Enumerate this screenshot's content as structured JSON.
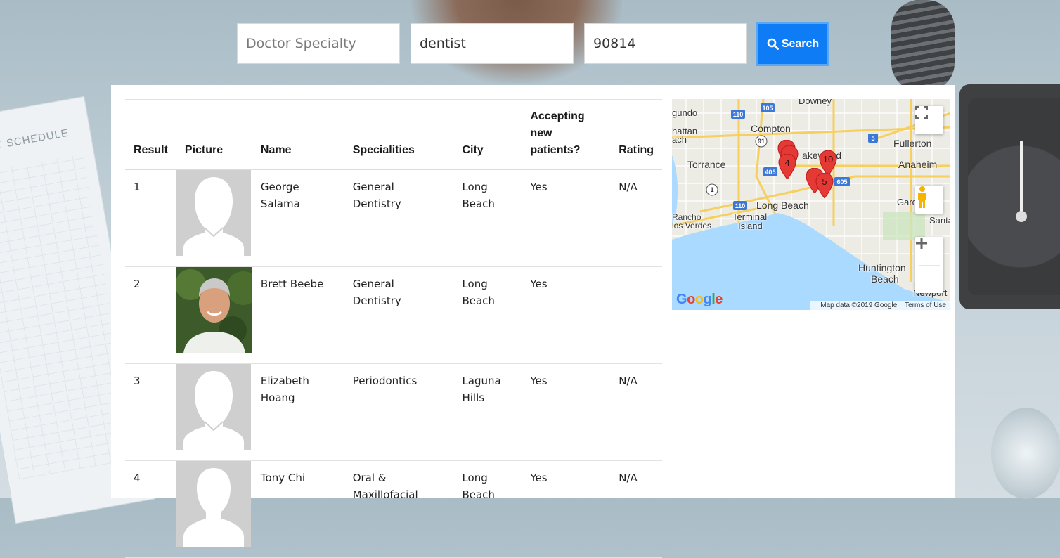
{
  "search": {
    "specialty_placeholder": "Doctor Specialty",
    "keyword_value": "dentist",
    "zip_value": "90814",
    "button_label": "Search"
  },
  "background": {
    "clipboard_text": "PORT SCHEDULE"
  },
  "table": {
    "headers": {
      "result": "Result",
      "picture": "Picture",
      "name": "Name",
      "specialities": "Specialities",
      "city": "City",
      "accepting": "Accepting new patients?",
      "rating": "Rating"
    },
    "rows": [
      {
        "result": "1",
        "name": "George Salama",
        "speciality": "General Dentistry",
        "city": "Long Beach",
        "accepting": "Yes",
        "rating": "N/A",
        "picture": "placeholder"
      },
      {
        "result": "2",
        "name": "Brett Beebe",
        "speciality": "General Dentistry",
        "city": "Long Beach",
        "accepting": "Yes",
        "rating": "",
        "picture": "photo"
      },
      {
        "result": "3",
        "name": "Elizabeth Hoang",
        "speciality": "Periodontics",
        "city": "Laguna Hills",
        "accepting": "Yes",
        "rating": "N/A",
        "picture": "placeholder"
      },
      {
        "result": "4",
        "name": "Tony Chi",
        "speciality": "Oral & Maxillofacial",
        "city": "Long Beach",
        "accepting": "Yes",
        "rating": "N/A",
        "picture": "placeholder"
      }
    ]
  },
  "map": {
    "labels": {
      "downey": "Downey",
      "compton": "Compton",
      "lakewood": "akewood",
      "fullerton": "Fullerton",
      "anaheim": "Anaheim",
      "torrance": "Torrance",
      "long_beach": "Long Beach",
      "garden": "Garden",
      "santa": "Santa",
      "rancho": "Rancho",
      "palos": "los Verdes",
      "terminal": "Terminal",
      "island": "Island",
      "huntington": "Huntington",
      "beach": "Beach",
      "newport": "Newport",
      "gundo": "gundo",
      "hattan": "hattan",
      "ach": "ach"
    },
    "shields": [
      "105",
      "110",
      "91",
      "5",
      "405",
      "605",
      "1",
      "110"
    ],
    "markers": [
      "4",
      "10",
      "5"
    ],
    "footer_data": "Map data ©2019 Google",
    "footer_terms": "Terms of Use",
    "logo": "Google",
    "icons": [
      "fullscreen-icon",
      "pegman-icon",
      "zoom-in-icon",
      "zoom-out-icon"
    ]
  },
  "colors": {
    "search_button": "#0e7df5",
    "marker": "#e53935",
    "water": "#aadaff"
  }
}
